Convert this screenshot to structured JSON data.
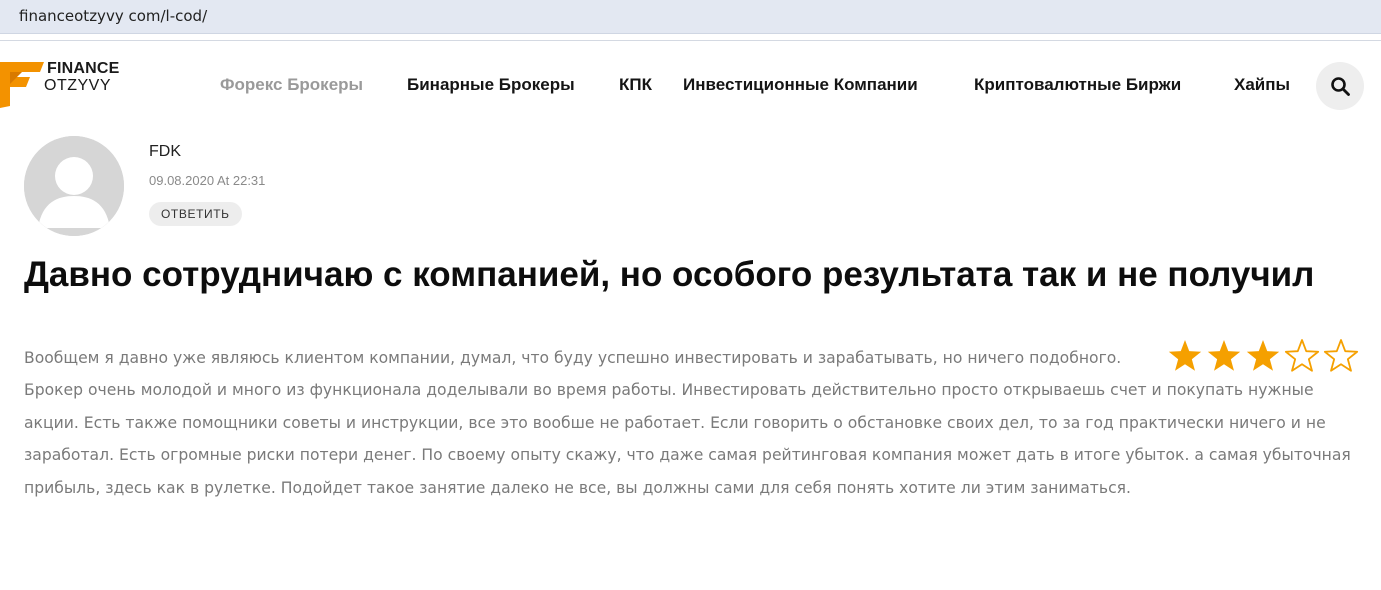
{
  "browser": {
    "url": "financeotzyvy com/l-cod/"
  },
  "logo": {
    "line1": "FINANCE",
    "line2": "OTZYVY",
    "accent_color": "#f39200"
  },
  "nav": {
    "items": [
      {
        "label": "Форекс Брокеры",
        "active": true
      },
      {
        "label": "Бинарные Брокеры",
        "active": false
      },
      {
        "label": "КПК",
        "active": false
      },
      {
        "label": "Инвестиционные Компании",
        "active": false
      },
      {
        "label": "Криптовалютные Биржи",
        "active": false
      },
      {
        "label": "Хайпы",
        "active": false
      }
    ],
    "search_icon": "search-icon"
  },
  "comment": {
    "author": "FDK",
    "date": "09.08.2020 At 22:31",
    "reply_label": "ОТВЕТИТЬ",
    "title": "Давно сотрудничаю с компанией, но особого результата так и не получил",
    "body": "Вообщем я давно уже являюсь клиентом компании, думал, что буду успешно инвестировать и зарабатывать, но ничего подобного. Брокер очень молодой и много из функционала доделывали во время работы. Инвестировать действительно просто открываешь счет и покупать нужные акции. Есть также помощники советы и инструкции, все это вообше не работает. Если говорить о обстановке своих дел, то за год практически ничего и не заработал. Есть огромные риски потери денег. По своему опыту скажу, что даже самая рейтинговая компания может дать в итоге убыток. а самая убыточная прибыль, здесь как в рулетке. Подойдет такое занятие далеко не все, вы должны сами для себя понять хотите ли этим заниматься.",
    "rating": {
      "value": 3,
      "max": 5,
      "color": "#f5a000"
    }
  }
}
